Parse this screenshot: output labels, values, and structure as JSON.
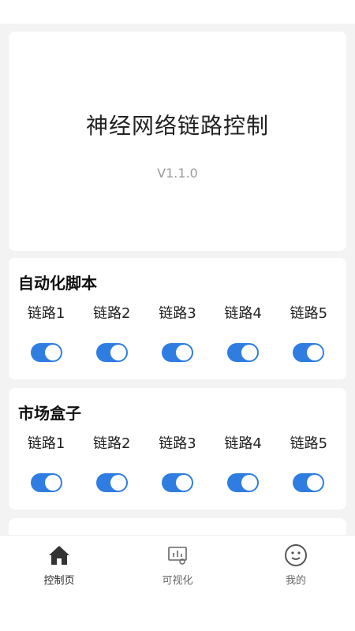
{
  "header": {
    "title": "神经网络链路控制",
    "version": "V1.1.0"
  },
  "sections": [
    {
      "title": "自动化脚本",
      "links": [
        {
          "label": "链路1",
          "on": true
        },
        {
          "label": "链路2",
          "on": true
        },
        {
          "label": "链路3",
          "on": true
        },
        {
          "label": "链路4",
          "on": true
        },
        {
          "label": "链路5",
          "on": true
        }
      ]
    },
    {
      "title": "市场盒子",
      "links": [
        {
          "label": "链路1",
          "on": true
        },
        {
          "label": "链路2",
          "on": true
        },
        {
          "label": "链路3",
          "on": true
        },
        {
          "label": "链路4",
          "on": true
        },
        {
          "label": "链路5",
          "on": true
        }
      ]
    }
  ],
  "tabs": [
    {
      "label": "控制页",
      "icon": "home-icon",
      "active": true
    },
    {
      "label": "可视化",
      "icon": "chart-icon",
      "active": false
    },
    {
      "label": "我的",
      "icon": "smiley-icon",
      "active": false
    }
  ],
  "colors": {
    "accent": "#2f7de1",
    "background": "#f3f3f3"
  }
}
